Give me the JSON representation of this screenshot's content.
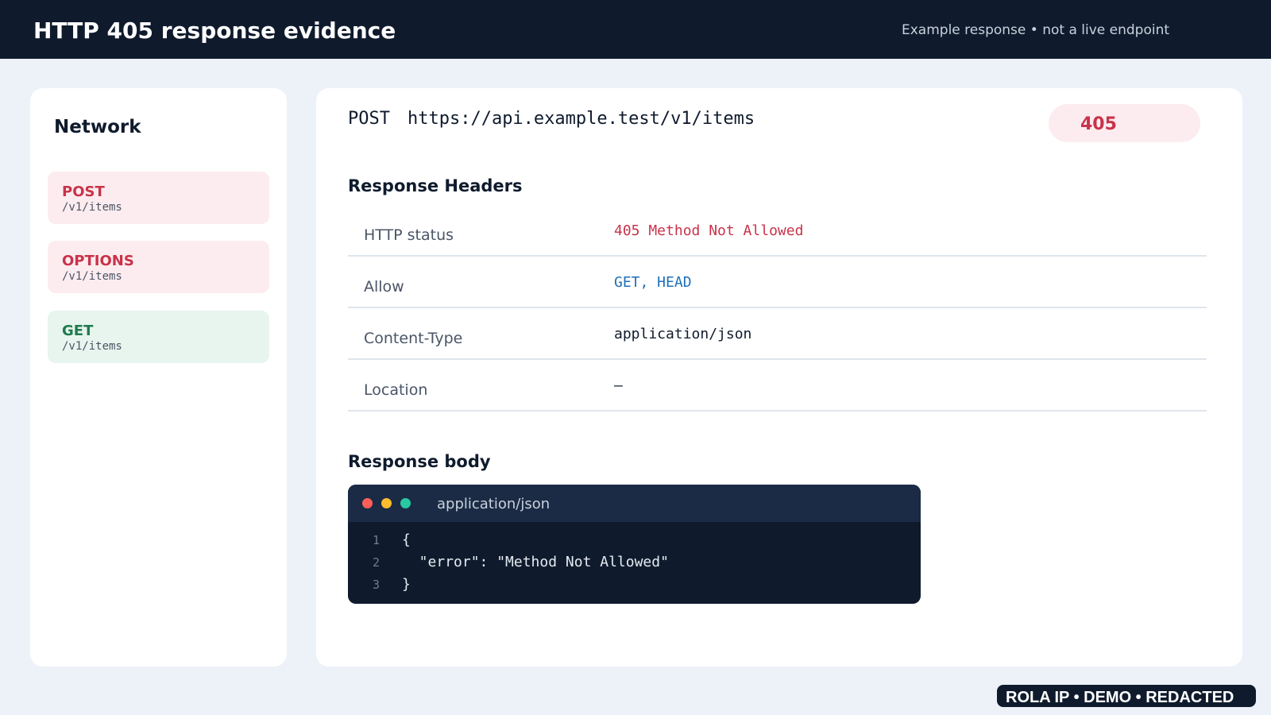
{
  "header": {
    "title": "HTTP 405 response evidence",
    "subtitle": "Example response • not a live endpoint"
  },
  "sidebar": {
    "title": "Network",
    "requests": [
      {
        "method": "POST",
        "path": "/v1/items",
        "state": "error"
      },
      {
        "method": "OPTIONS",
        "path": "/v1/items",
        "state": "error"
      },
      {
        "method": "GET",
        "path": "/v1/items",
        "state": "ok"
      }
    ]
  },
  "request": {
    "method": "POST",
    "url": "https://api.example.test/v1/items",
    "status_code": "405"
  },
  "response_headers": {
    "title": "Response Headers",
    "rows": [
      {
        "key": "HTTP status",
        "value": "405 Method Not Allowed"
      },
      {
        "key": "Allow",
        "value": "GET, HEAD"
      },
      {
        "key": "Content-Type",
        "value": "application/json"
      },
      {
        "key": "Location",
        "value": "—"
      }
    ]
  },
  "response_body": {
    "title": "Response body",
    "content_type": "application/json",
    "lines": [
      {
        "n": "1",
        "text": "{"
      },
      {
        "n": "2",
        "text": "  \"error\": \"Method Not Allowed\""
      },
      {
        "n": "3",
        "text": "}"
      }
    ]
  },
  "watermark": "ROLA IP  •  DEMO  •  REDACTED",
  "colors": {
    "topbar": "#0f1b2d",
    "error": "#c8334a",
    "error_bg": "#fdecef",
    "success": "#1f7a4d",
    "success_bg": "#e7f5ee",
    "link_blue": "#1f6fb8"
  }
}
